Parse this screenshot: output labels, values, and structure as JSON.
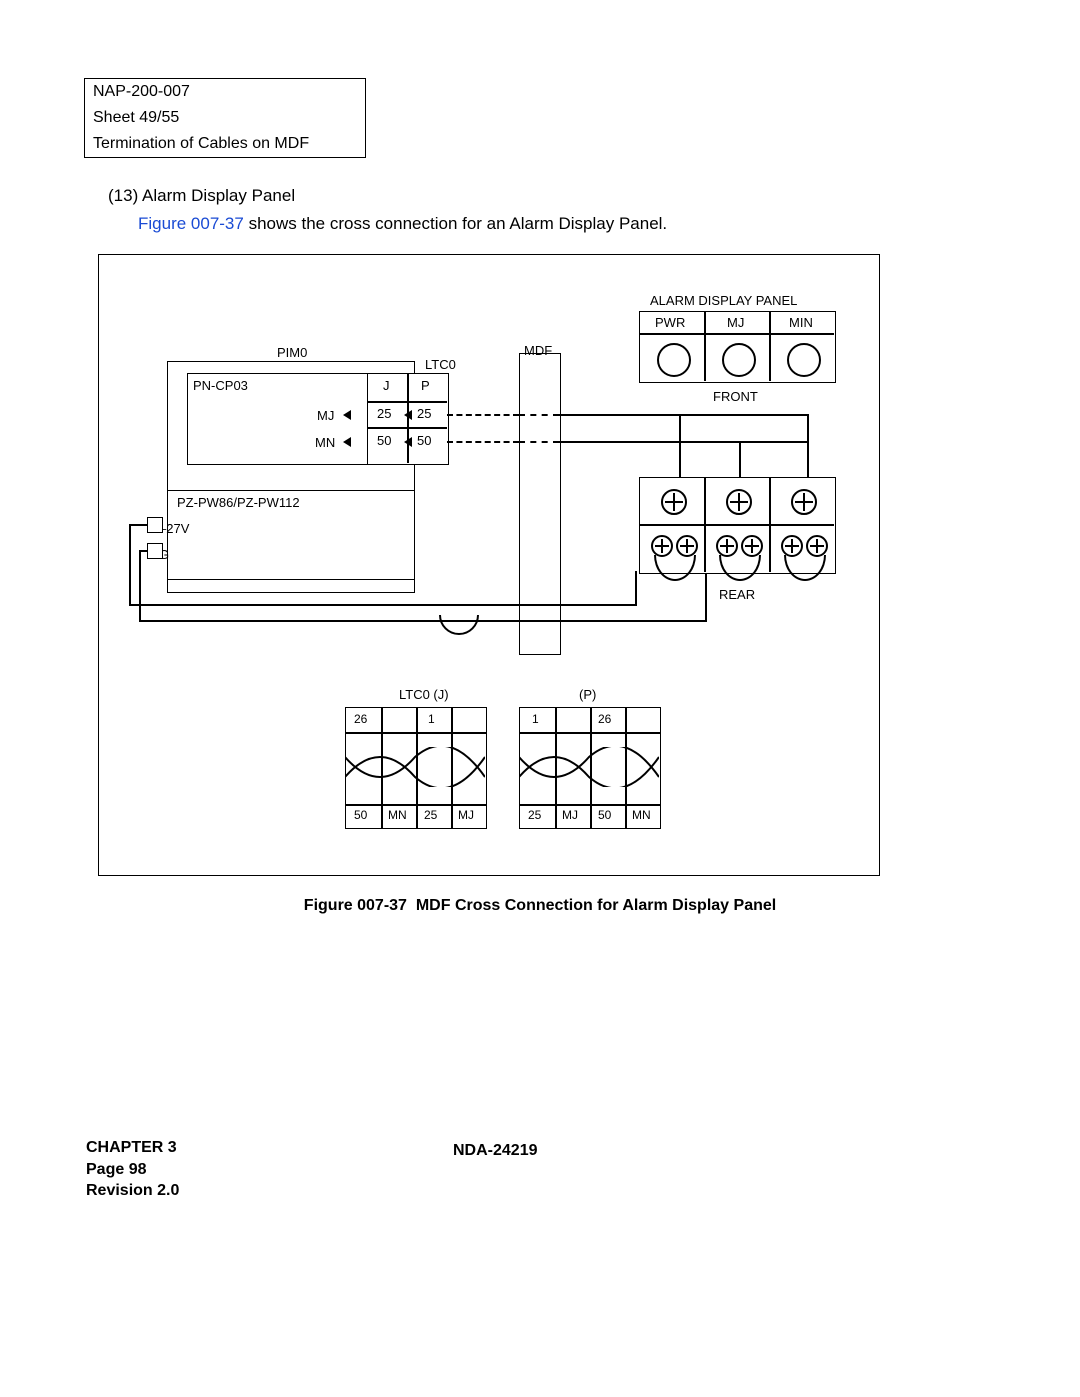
{
  "header": {
    "line1": "NAP-200-007",
    "line2": "Sheet 49/55",
    "line3": "Termination of Cables on MDF"
  },
  "section": {
    "number": "(13)",
    "title": "Alarm Display Panel"
  },
  "body": {
    "figref": "Figure 007-37",
    "rest": " shows the cross connection for an Alarm Display Panel."
  },
  "diagram": {
    "pim0": "PIM0",
    "mdf": "MDF",
    "ltc0": "LTC0",
    "pn_cp03": "PN-CP03",
    "j": "J",
    "p": "P",
    "mj": "MJ",
    "mn": "MN",
    "c25a": "25",
    "c25b": "25",
    "c50a": "50",
    "c50b": "50",
    "pz": "PZ-PW86/PZ-PW112",
    "neg27v": "–27V",
    "g": "G",
    "alarm_title": "ALARM DISPLAY PANEL",
    "pwr": "PWR",
    "mj2": "MJ",
    "min": "MIN",
    "front": "FRONT",
    "rear": "REAR",
    "ltc0j": "LTC0 (J)",
    "pp": "(P)",
    "g26": "26",
    "g1": "1",
    "g1b": "1",
    "g26b": "26",
    "g50": "50",
    "gmn": "MN",
    "g25": "25",
    "gmj": "MJ",
    "g25b": "25",
    "gmjb": "MJ",
    "g50b": "50",
    "gmnb": "MN"
  },
  "caption": {
    "prefix": "Figure 007-37",
    "title": "MDF Cross Connection for Alarm Display Panel"
  },
  "footer": {
    "chapter": "CHAPTER 3",
    "page": "Page 98",
    "revision": "Revision 2.0",
    "docno": "NDA-24219"
  }
}
